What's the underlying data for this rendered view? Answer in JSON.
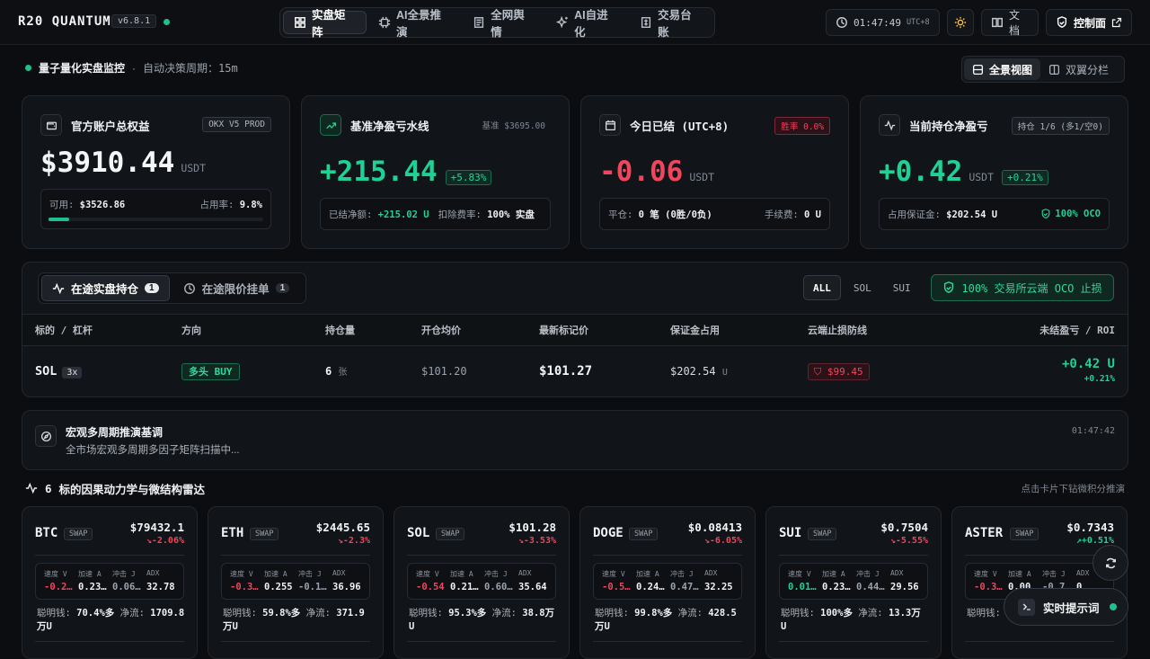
{
  "brand": {
    "name": "R20 QUANTUM",
    "version": "v6.8.1"
  },
  "nav": [
    {
      "label": "实盘矩阵",
      "icon": "grid-icon"
    },
    {
      "label": "AI全景推演",
      "icon": "cpu-icon"
    },
    {
      "label": "全网舆情",
      "icon": "newspaper-icon"
    },
    {
      "label": "AI自进化",
      "icon": "sparkles-icon"
    },
    {
      "label": "交易台账",
      "icon": "ledger-icon"
    }
  ],
  "topright": {
    "time": "01:47:49",
    "tz": "UTC+8",
    "docs": "文档",
    "console": "控制面"
  },
  "subhead": {
    "title": "量子量化实盘监控",
    "cycle": "自动决策周期：15m"
  },
  "view": {
    "full": "全景视图",
    "split": "双翼分栏"
  },
  "cards": [
    {
      "title": "官方账户总权益",
      "badge": "OKX V5 PROD",
      "value": "$3910.44",
      "unit": "USDT",
      "foot_l_label": "可用:",
      "foot_l_val": "$3526.86",
      "foot_r_label": "占用率:",
      "foot_r_val": "9.8%",
      "usage": 0.098
    },
    {
      "title": "基准净盈亏水线",
      "badge": "基准 $3695.00",
      "value": "+215.44",
      "pct": "+5.83%",
      "foot_l_label": "已结净额:",
      "foot_l_val": "+215.02 U",
      "foot_r_label": "扣除费率:",
      "foot_r_val": "100% 实盘"
    },
    {
      "title": "今日已结 (UTC+8)",
      "badge": "胜率 0.0%",
      "value": "-0.06",
      "unit": "USDT",
      "foot_l_label": "平仓:",
      "foot_l_val": "0 笔 (0胜/0负)",
      "foot_r_label": "手续费:",
      "foot_r_val": "0 U"
    },
    {
      "title": "当前持仓净盈亏",
      "badge": "持仓 1/6 (多1/空0)",
      "value": "+0.42",
      "unit": "USDT",
      "pct": "+0.21%",
      "foot_l_label": "占用保证金:",
      "foot_l_val": "$202.54 U",
      "foot_r_val": "100% OCO"
    }
  ],
  "positions": {
    "tab_open": "在途实盘持仓",
    "tab_open_count": "1",
    "tab_limit": "在途限价挂单",
    "tab_limit_count": "1",
    "filters": [
      "ALL",
      "SOL",
      "SUI"
    ],
    "oco": "100% 交易所云端 OCO 止损",
    "headers": [
      "标的 / 杠杆",
      "方向",
      "持仓量",
      "开仓均价",
      "最新标记价",
      "保证金占用",
      "云端止损防线",
      "未结盈亏 / ROI"
    ],
    "row": {
      "symbol": "SOL",
      "lev": "3x",
      "dir": "多头 BUY",
      "qty": "6",
      "qty_unit": "张",
      "entry": "$101.20",
      "mark": "$101.27",
      "margin": "$202.54",
      "margin_unit": "U",
      "sl": "$99.45",
      "pnl": "+0.42 U",
      "roi": "+0.21%"
    }
  },
  "macro": {
    "title": "宏观多周期推演基调",
    "text": "全市场宏观多周期多因子矩阵扫描中...",
    "time": "01:47:42"
  },
  "radar": {
    "count": "6",
    "title": "标的因果动力学与微结构雷达",
    "hint": "点击卡片下钻微积分推演"
  },
  "metric_labels": [
    "速度 V",
    "加速 A",
    "冲击 J",
    "ADX"
  ],
  "flow_labels": {
    "smart": "聪明钱:",
    "net": "净流:"
  },
  "symbols": [
    {
      "name": "BTC",
      "type": "SWAP",
      "price": "$79432.1",
      "chg": "↘-2.06%",
      "up": false,
      "m": [
        "-0.2…",
        "0.23…",
        "0.06…",
        "32.78"
      ],
      "mc": [
        "red",
        "w",
        "g",
        "w"
      ],
      "smart": "70.4%多",
      "net": "1709.8万U"
    },
    {
      "name": "ETH",
      "type": "SWAP",
      "price": "$2445.65",
      "chg": "↘-2.3%",
      "up": false,
      "m": [
        "-0.3…",
        "0.255",
        "-0.1…",
        "36.96"
      ],
      "mc": [
        "red",
        "w",
        "g",
        "w"
      ],
      "smart": "59.8%多",
      "net": "371.9万U"
    },
    {
      "name": "SOL",
      "type": "SWAP",
      "price": "$101.28",
      "chg": "↘-3.53%",
      "up": false,
      "m": [
        "-0.54",
        "0.21…",
        "0.60…",
        "35.64"
      ],
      "mc": [
        "red",
        "w",
        "g",
        "w"
      ],
      "smart": "95.3%多",
      "net": "38.8万 U"
    },
    {
      "name": "DOGE",
      "type": "SWAP",
      "price": "$0.08413",
      "chg": "↘-6.05%",
      "up": false,
      "m": [
        "-0.5…",
        "0.24…",
        "0.47…",
        "32.25"
      ],
      "mc": [
        "red",
        "w",
        "g",
        "w"
      ],
      "smart": "99.8%多",
      "net": "428.5万U"
    },
    {
      "name": "SUI",
      "type": "SWAP",
      "price": "$0.7504",
      "chg": "↘-5.55%",
      "up": false,
      "m": [
        "0.01…",
        "0.23…",
        "0.44…",
        "29.56"
      ],
      "mc": [
        "green",
        "w",
        "g",
        "w"
      ],
      "smart": "100%多",
      "net": "13.3万 U"
    },
    {
      "name": "ASTER",
      "type": "SWAP",
      "price": "$0.7343",
      "chg": "↗+0.51%",
      "up": true,
      "m": [
        "-0.3…",
        "0.00…",
        "-0.7…",
        "0"
      ],
      "mc": [
        "red",
        "w",
        "g",
        "w"
      ],
      "smart": "",
      "net": ""
    }
  ],
  "prompt": "实时提示词",
  "colors": {
    "green": "#1fd195",
    "red": "#f0455c",
    "bg": "#0b0d10"
  }
}
